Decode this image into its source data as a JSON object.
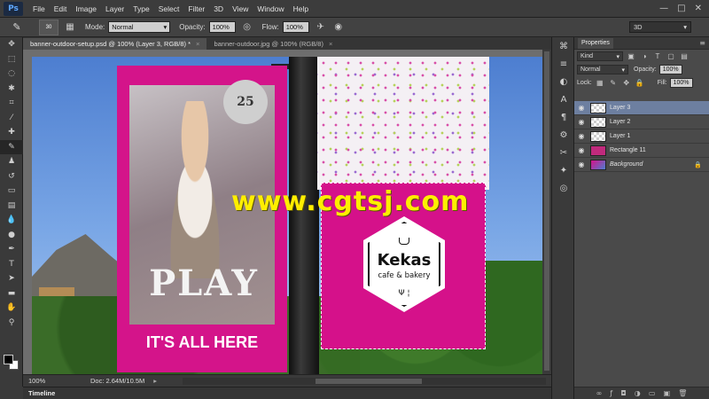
{
  "app": {
    "logo": "Ps"
  },
  "menu": [
    "File",
    "Edit",
    "Image",
    "Layer",
    "Type",
    "Select",
    "Filter",
    "3D",
    "View",
    "Window",
    "Help"
  ],
  "window_controls": {
    "minimize": "—",
    "maximize": "□",
    "close": "✕"
  },
  "options": {
    "brush_size": "30",
    "mode_label": "Mode:",
    "mode_value": "Normal",
    "opacity_label": "Opacity:",
    "opacity_value": "100%",
    "flow_label": "Flow:",
    "flow_value": "100%",
    "workspace": "3D"
  },
  "tabs": [
    {
      "label": "banner-outdoor-setup.psd @ 100% (Layer 3, RGB/8) *",
      "close": "×"
    },
    {
      "label": "banner-outdoor.jpg @ 100% (RGB/8)",
      "close": "×"
    }
  ],
  "canvas": {
    "badge_text": "25",
    "play_text": "PLAY",
    "tagline_text": "IT'S ALL HERE",
    "brand_text": "Kekas",
    "brand_sub": "cafe & bakery",
    "watermark": "www.cgtsj.com",
    "utensils": "Ψ ¦"
  },
  "status": {
    "zoom": "100%",
    "doc": "Doc: 2.64M/10.5M",
    "arrow": "▸"
  },
  "timeline": {
    "label": "Timeline"
  },
  "panel": {
    "tab_label": "Properties",
    "filter_kind": "Kind",
    "blend_mode": "Normal",
    "opacity_label": "Opacity:",
    "opacity_value": "100%",
    "lock_label": "Lock:",
    "fill_label": "Fill:",
    "fill_value": "100%"
  },
  "layers": [
    {
      "name": "Layer 3",
      "selected": true,
      "thumb": "trans"
    },
    {
      "name": "Layer 2",
      "selected": false,
      "thumb": "trans"
    },
    {
      "name": "Layer 1",
      "selected": false,
      "thumb": "trans"
    },
    {
      "name": "Rectangle 11",
      "selected": false,
      "thumb": "shape"
    },
    {
      "name": "Background",
      "selected": false,
      "thumb": "photo",
      "locked": true
    }
  ],
  "colors": {
    "selection_highlight": "#6d7fa0",
    "banner_magenta": "#d5118a",
    "watermark_yellow": "#ffee00"
  }
}
